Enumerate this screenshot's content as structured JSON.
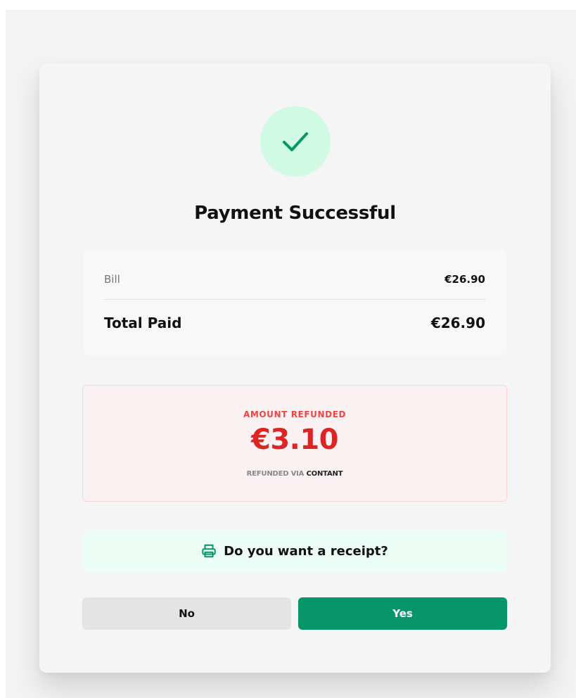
{
  "colors": {
    "success_green": "#079669",
    "success_bg": "#d1fae5",
    "refund_red": "#dc2626",
    "refund_bg": "#faf2f2",
    "receipt_bg": "#ecfdf5"
  },
  "header": {
    "icon": "check-icon",
    "title": "Payment Successful"
  },
  "summary": {
    "bill_label": "Bill",
    "bill_value": "€26.90",
    "total_label": "Total Paid",
    "total_value": "€26.90"
  },
  "refund": {
    "label": "AMOUNT REFUNDED",
    "amount": "€3.10",
    "via_prefix": "REFUNDED VIA",
    "via_method": "CONTANT"
  },
  "receipt": {
    "icon": "printer-icon",
    "question": "Do you want a receipt?"
  },
  "buttons": {
    "no_label": "No",
    "yes_label": "Yes"
  }
}
